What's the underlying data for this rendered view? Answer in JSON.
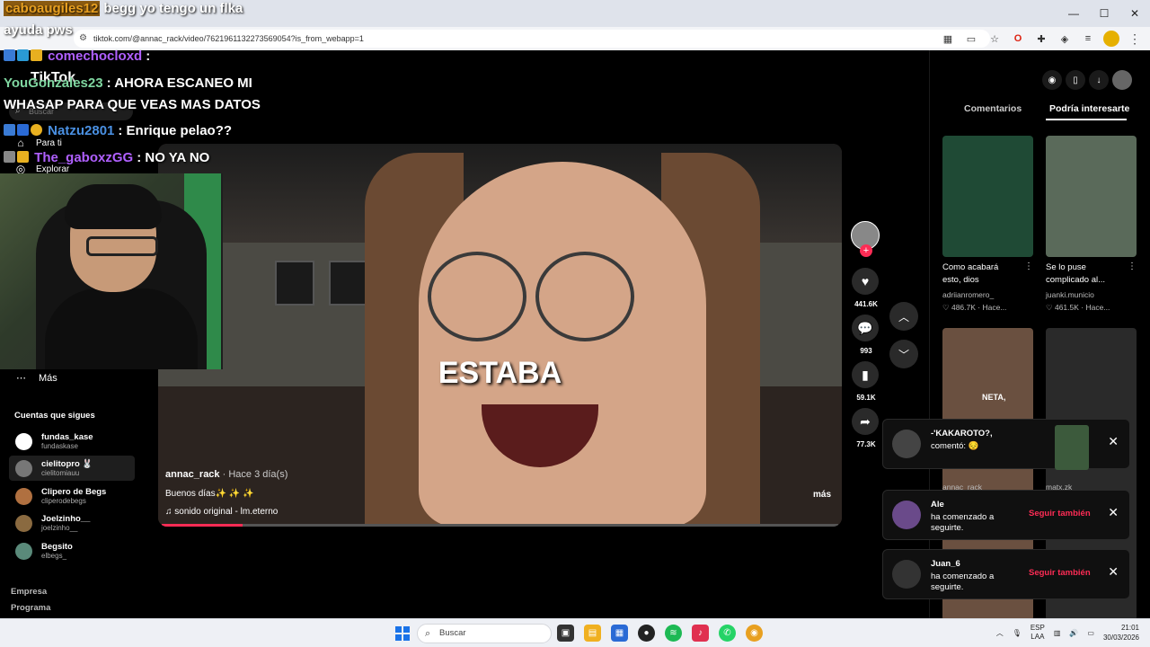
{
  "browser": {
    "url": "tiktok.com/@annac_rack/video/7621961132273569054?is_from_webapp=1",
    "window_controls": [
      "—",
      "☐",
      "✕"
    ]
  },
  "stream_chat": [
    {
      "user": "caboaugiles12",
      "message": "begg yo tengo un flka"
    },
    {
      "user": "",
      "message": "ayuda pws"
    },
    {
      "user": "comechocloxd",
      "message": ":"
    },
    {
      "user": "YouGonzales23",
      "message": ": AHORA ESCANEO MI"
    },
    {
      "user": "",
      "message": "WHASAP PARA QUE VEAS MAS DATOS"
    },
    {
      "user": "Natzu2801",
      "message": ": Enrique pelao??"
    },
    {
      "user": "The_gaboxzGG",
      "message": ": NO YA NO"
    }
  ],
  "sidebar": {
    "logo": "TikTok",
    "search_placeholder": "Buscar",
    "nav": [
      {
        "label": "Para ti",
        "icon": "home-icon"
      },
      {
        "label": "Explorar",
        "icon": "compass-icon"
      }
    ],
    "more_label": "Más",
    "follows_title": "Cuentas que sigues",
    "follows": [
      {
        "name": "fundas_kase",
        "handle": "fundaskase",
        "color": "#ffffff"
      },
      {
        "name": "cielitopro 🐰",
        "handle": "cielitomiauu",
        "color": "#777777"
      },
      {
        "name": "Clipero de Begs",
        "handle": "cliperodebegs",
        "color": "#b07040"
      },
      {
        "name": "Joelzinho__",
        "handle": "joelzinho__",
        "color": "#8a6a40"
      },
      {
        "name": "Begsito",
        "handle": "elbegs_",
        "color": "#5a8a7a"
      }
    ],
    "footer": [
      "Empresa",
      "Programa"
    ]
  },
  "video": {
    "caption_overlay": "ESTABA",
    "author": "annac_rack",
    "time": "· Hace 3 día(s)",
    "description": "Buenos días✨ ✨ ✨",
    "sound": "♫  sonido original - lm.eterno",
    "more": "más",
    "progress": 0.12
  },
  "actions": {
    "likes": "441.6K",
    "comments": "993",
    "saves": "59.1K",
    "shares": "77.3K"
  },
  "right_panel": {
    "tabs": [
      "Comentarios",
      "Podría interesarte"
    ],
    "videos": [
      {
        "caption": "Como acabará esto, dios",
        "author": "adriianromero_",
        "stats": "♡ 486.7K · Hace...",
        "color": "#1f4a35"
      },
      {
        "caption": "Se lo puse complicado al...",
        "author": "juanki.municio",
        "stats": "♡ 461.5K · Hace...",
        "color": "#5a6a5a"
      },
      {
        "caption": "NETA,",
        "author": "annac_rack",
        "stats": "",
        "color": "#6a5040"
      },
      {
        "caption": "",
        "author": "matx.zk",
        "stats": "",
        "color": "#2a2a2a"
      }
    ]
  },
  "notifications": [
    {
      "name": "-'KAKAROTO?,",
      "text": "comentó: 😔",
      "button": "",
      "close": "✕"
    },
    {
      "name": "Ale",
      "text": "ha comenzado a seguirte.",
      "button": "Seguir también",
      "close": "✕"
    },
    {
      "name": "Juan_6",
      "text": "ha comenzado a seguirte.",
      "button": "Seguir también",
      "close": "✕"
    }
  ],
  "taskbar": {
    "search_placeholder": "Buscar",
    "lang": "ESP",
    "lang_sub": "LAA",
    "time": "21:01",
    "date": "30/03/2026"
  },
  "colors": {
    "accent": "#fe2c55",
    "bg": "#000000"
  }
}
